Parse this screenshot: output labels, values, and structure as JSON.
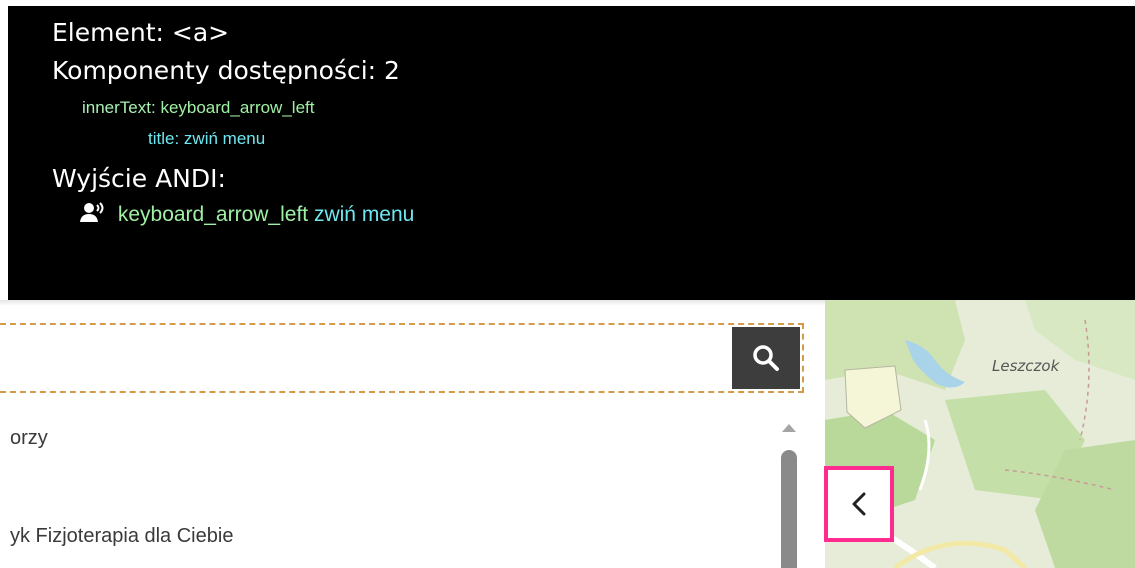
{
  "andi": {
    "element_line": "Element: <a>",
    "components_line": "Komponenty dostępności: 2",
    "innertext_key": "innerText:",
    "innertext_value": "keyboard_arrow_left",
    "title_key": "title:",
    "title_value": "zwiń menu",
    "output_label": "Wyjście ANDI:",
    "output_innertext": "keyboard_arrow_left",
    "output_title": "zwiń menu",
    "speaker_icon": "speaker-icon"
  },
  "search": {
    "value": "",
    "icon": "search-icon"
  },
  "list": {
    "items": [
      "orzy",
      "yk Fizjoterapia dla Ciebie"
    ]
  },
  "map": {
    "label": "Leszczok"
  },
  "collapse": {
    "icon": "chevron-left-icon",
    "highlight_color": "#ff2b8f"
  },
  "colors": {
    "andi_background": "#000000",
    "green_text": "#9ff0a5",
    "cyan_text": "#6fe6f0",
    "search_button": "#3d3d3d",
    "dashed_outline": "#d69b4a"
  }
}
